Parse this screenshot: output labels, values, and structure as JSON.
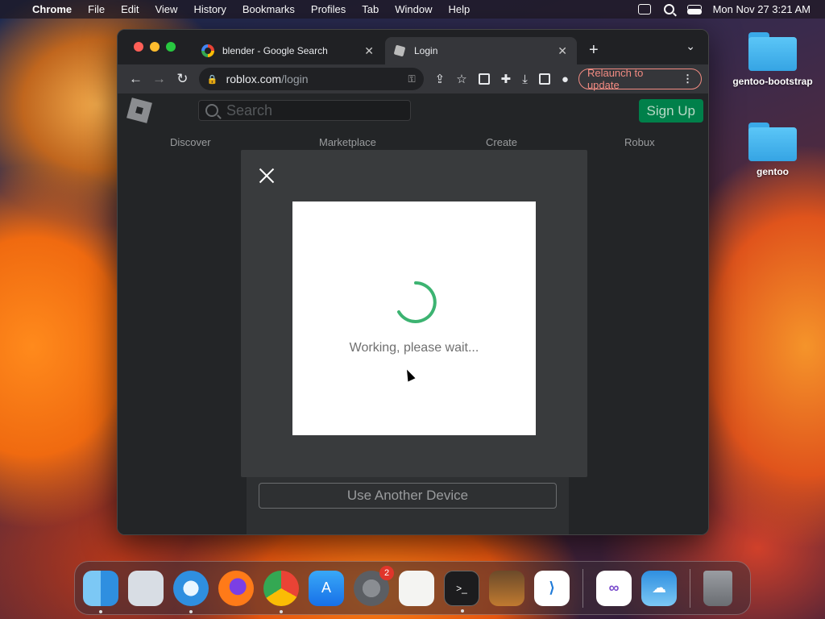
{
  "menubar": {
    "app_name": "Chrome",
    "items": [
      "File",
      "Edit",
      "View",
      "History",
      "Bookmarks",
      "Profiles",
      "Tab",
      "Window",
      "Help"
    ],
    "clock": "Mon Nov 27  3:21 AM"
  },
  "desktop": {
    "icons": [
      {
        "label": "gentoo-bootstrap"
      },
      {
        "label": "gentoo"
      }
    ]
  },
  "browser": {
    "tabs": [
      {
        "title": "blender - Google Search",
        "favicon": "google-icon",
        "active": false
      },
      {
        "title": "Login",
        "favicon": "roblox-icon",
        "active": true
      }
    ],
    "url_host": "roblox.com",
    "url_path": "/login",
    "relaunch_label": "Relaunch to update"
  },
  "page": {
    "search_placeholder": "Search",
    "signup_label": "Sign Up",
    "nav": [
      "Discover",
      "Marketplace",
      "Create",
      "Robux"
    ],
    "modal": {
      "status_text": "Working, please wait..."
    },
    "another_device_label": "Use Another Device"
  },
  "dock": {
    "apps": [
      {
        "name": "Finder",
        "icon": "finder-icon",
        "running": true
      },
      {
        "name": "Launchpad",
        "icon": "launchpad-icon",
        "running": false
      },
      {
        "name": "Safari",
        "icon": "safari-icon",
        "running": true
      },
      {
        "name": "Firefox",
        "icon": "firefox-icon",
        "running": false
      },
      {
        "name": "Chrome",
        "icon": "chrome-icon",
        "running": true
      },
      {
        "name": "App Store",
        "icon": "app-store-icon",
        "running": false
      },
      {
        "name": "System Settings",
        "icon": "settings-icon",
        "running": false,
        "badge": "2"
      },
      {
        "name": "TextEdit",
        "icon": "textedit-icon",
        "running": false
      },
      {
        "name": "Terminal",
        "icon": "terminal-icon",
        "running": true
      },
      {
        "name": "GarageBand",
        "icon": "garageband-icon",
        "running": false
      },
      {
        "name": "Visual Studio Code",
        "icon": "vscode-icon",
        "running": false
      },
      {
        "name": "Visual Studio",
        "icon": "visual-studio-icon",
        "running": false
      },
      {
        "name": "Weather",
        "icon": "weather-icon",
        "running": false
      },
      {
        "name": "Trash",
        "icon": "trash-icon",
        "running": false
      }
    ]
  },
  "colors": {
    "signup_green": "#00804a",
    "spinner_green": "#3cb371",
    "relaunch_red": "#f28b82"
  }
}
